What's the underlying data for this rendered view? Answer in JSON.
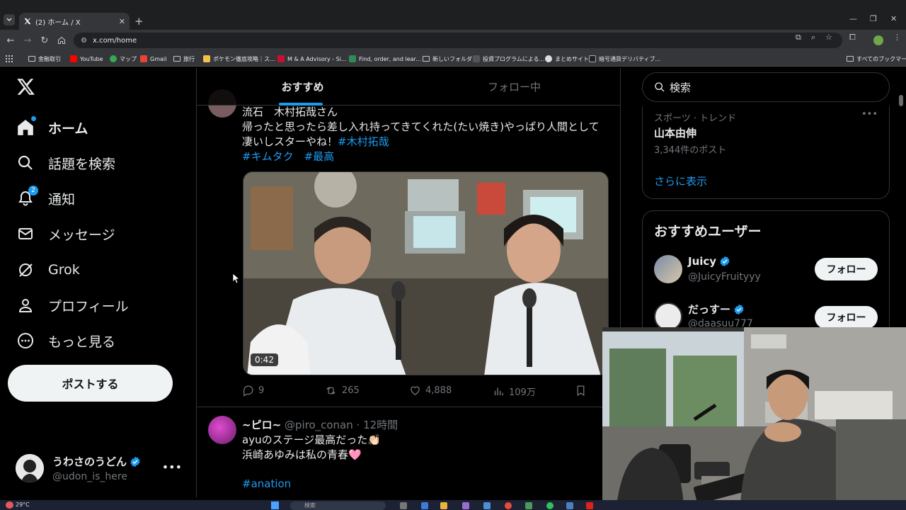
{
  "browser": {
    "tab_title": "(2) ホーム / X",
    "url": "x.com/home",
    "new_tab": "+",
    "bookmarks": [
      {
        "label": "金融取引",
        "icon": "folder-icon"
      },
      {
        "label": "YouTube",
        "icon": "youtube-icon"
      },
      {
        "label": "マップ",
        "icon": "maps-icon"
      },
      {
        "label": "Gmail",
        "icon": "gmail-icon"
      },
      {
        "label": "旅行",
        "icon": "folder-icon"
      },
      {
        "label": "ポケモン徹底攻略｜ス...",
        "icon": "pokemon-icon"
      },
      {
        "label": "M & A Advisory - Si...",
        "icon": "ma-icon"
      },
      {
        "label": "Find, order, and lear...",
        "icon": "find-icon"
      },
      {
        "label": "新しいフォルダ",
        "icon": "folder-icon"
      },
      {
        "label": "投資プログラムによる...",
        "icon": "invest-icon"
      },
      {
        "label": "まとめサイト",
        "icon": "matome-icon"
      },
      {
        "label": "暗号通貨デリバティブ...",
        "icon": "crypto-icon"
      }
    ],
    "all_bookmarks": "すべてのブックマーク"
  },
  "sidebar": {
    "items": [
      {
        "label": "ホーム",
        "icon": "home-icon"
      },
      {
        "label": "話題を検索",
        "icon": "search-icon"
      },
      {
        "label": "通知",
        "icon": "bell-icon",
        "badge": "2"
      },
      {
        "label": "メッセージ",
        "icon": "mail-icon"
      },
      {
        "label": "Grok",
        "icon": "grok-icon"
      },
      {
        "label": "プロフィール",
        "icon": "profile-icon"
      },
      {
        "label": "もっと見る",
        "icon": "more-circle-icon"
      }
    ],
    "post_button": "ポストする",
    "account": {
      "name": "うわさのうどん",
      "handle": "@udon_is_here"
    }
  },
  "feed": {
    "tabs": {
      "for_you": "おすすめ",
      "following": "フォロー中"
    },
    "tweet1": {
      "line1": "流石　木村拓哉さん",
      "line2": "帰ったと思ったら差し入れ持ってきてくれた(たい焼き)やっぱり人間として",
      "line3_text": "凄いしスターやね！",
      "line3_tag": "#木村拓哉",
      "tags": [
        "#キムタク",
        "#最高"
      ],
      "video_time": "0:42",
      "replies": "9",
      "reposts": "265",
      "likes": "4,888",
      "views": "109万"
    },
    "tweet2": {
      "name": "~ピロ~",
      "handle": "@piro_conan",
      "time": "· 12時間",
      "line1": "ayuのステージ最高だった👏🏻",
      "line2": "浜崎あゆみは私の青春🩷",
      "tag": "#anation"
    }
  },
  "right": {
    "search_placeholder": "検索",
    "trend": {
      "category": "スポーツ · トレンド",
      "name": "山本由伸",
      "count": "3,344件のポスト",
      "more": "さらに表示"
    },
    "recommend": {
      "title": "おすすめユーザー",
      "users": [
        {
          "name": "Juicy",
          "handle": "@JuicyFruityyy",
          "button": "フォロー"
        },
        {
          "name": "だっすー",
          "handle": "@daasuu777",
          "button": "フォロー"
        }
      ]
    }
  },
  "taskbar": {
    "weather": "29°C",
    "search": "検索"
  },
  "colors": {
    "accent": "#1d9bf0",
    "background": "#000000",
    "muted": "#71767b"
  }
}
